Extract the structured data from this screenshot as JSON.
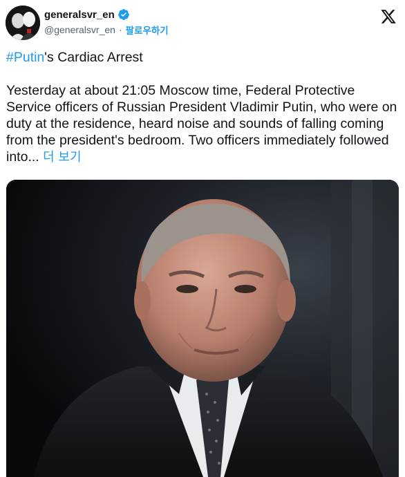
{
  "author": {
    "display_name": "generalsvr_en",
    "handle": "@generalsvr_en",
    "separator": "·",
    "follow_label": "팔로우하기",
    "verified": true,
    "avatar_icon": "avatar-silhouettes"
  },
  "tweet": {
    "hashtag": "#Putin",
    "title_rest": "'s Cardiac Arrest",
    "body": "Yesterday at about 21:05 Moscow time, Federal Protective Service officers of Russian President Vladimir Putin, who were on duty at the residence, heard noise and sounds of falling coming from the president's bedroom. Two officers immediately followed into...",
    "show_more_label": "더 보기"
  },
  "media": {
    "type": "photo",
    "subject": "portrait-photo"
  },
  "colors": {
    "accent": "#1d9bf0",
    "text": "#0f1419",
    "secondary": "#536471",
    "verified": "#1d9bf0"
  },
  "icons": [
    "verified-badge-icon",
    "x-logo-icon"
  ]
}
